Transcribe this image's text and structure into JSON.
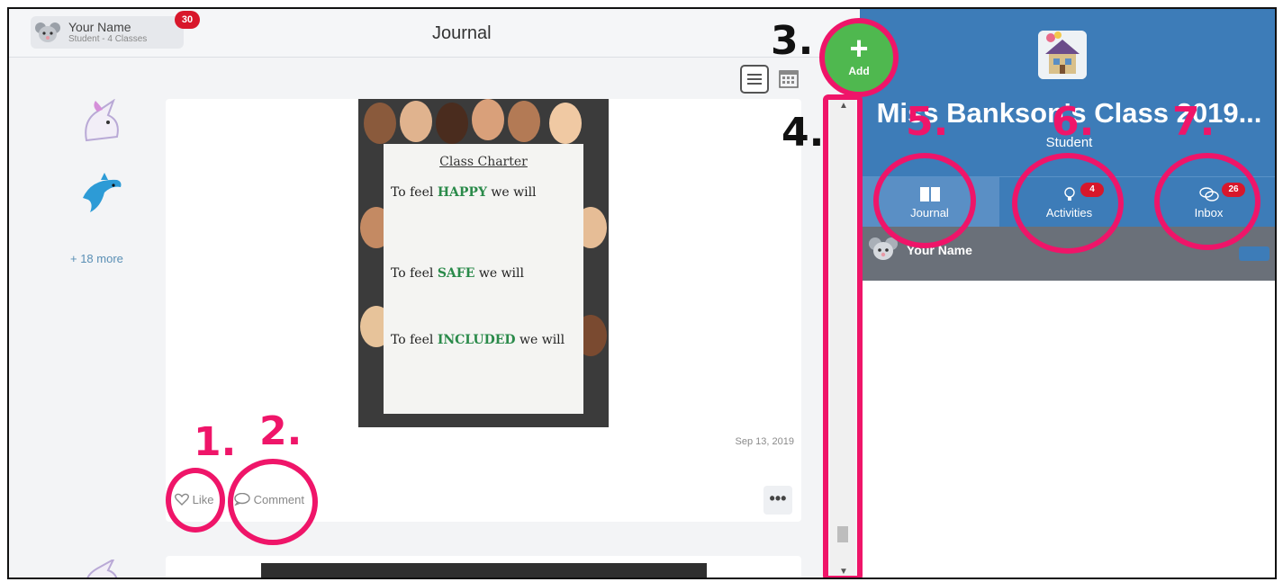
{
  "header": {
    "user_name": "Your Name",
    "user_sub": "Student - 4 Classes",
    "notification_count": "30",
    "page_title": "Journal"
  },
  "feed": {
    "more_link": "+ 18 more",
    "post": {
      "poster_title": "Class Charter",
      "lines": [
        {
          "pre": "To feel ",
          "strong": "HAPPY",
          "post": " we will"
        },
        {
          "pre": "To feel ",
          "strong": "SAFE",
          "post": " we will"
        },
        {
          "pre": "To feel ",
          "strong": "INCLUDED",
          "post": " we will"
        }
      ],
      "date": "Sep 13, 2019",
      "like_label": "Like",
      "comment_label": "Comment",
      "more_label": "•••"
    }
  },
  "add": {
    "label": "Add",
    "symbol": "+"
  },
  "class_panel": {
    "class_name": "Miss Bankson's Class 2019...",
    "role": "Student",
    "tabs": [
      {
        "label": "Journal",
        "badge": ""
      },
      {
        "label": "Activities",
        "badge": "4"
      },
      {
        "label": "Inbox",
        "badge": "26"
      }
    ],
    "member_name": "Your Name"
  },
  "annotations": [
    "1.",
    "2.",
    "3.",
    "4.",
    "5.",
    "6.",
    "7."
  ],
  "colors": {
    "annotation": "#ef1569",
    "header_blue": "#3d7cb8",
    "add_green": "#4fb84f",
    "badge_red": "#d8172b"
  },
  "icons": [
    "mouse-avatar-icon",
    "unicorn-icon",
    "dolphin-icon",
    "list-view-icon",
    "calendar-view-icon",
    "heart-icon",
    "comment-icon",
    "house-icon",
    "book-icon",
    "lightbulb-icon",
    "chat-bubbles-icon"
  ]
}
